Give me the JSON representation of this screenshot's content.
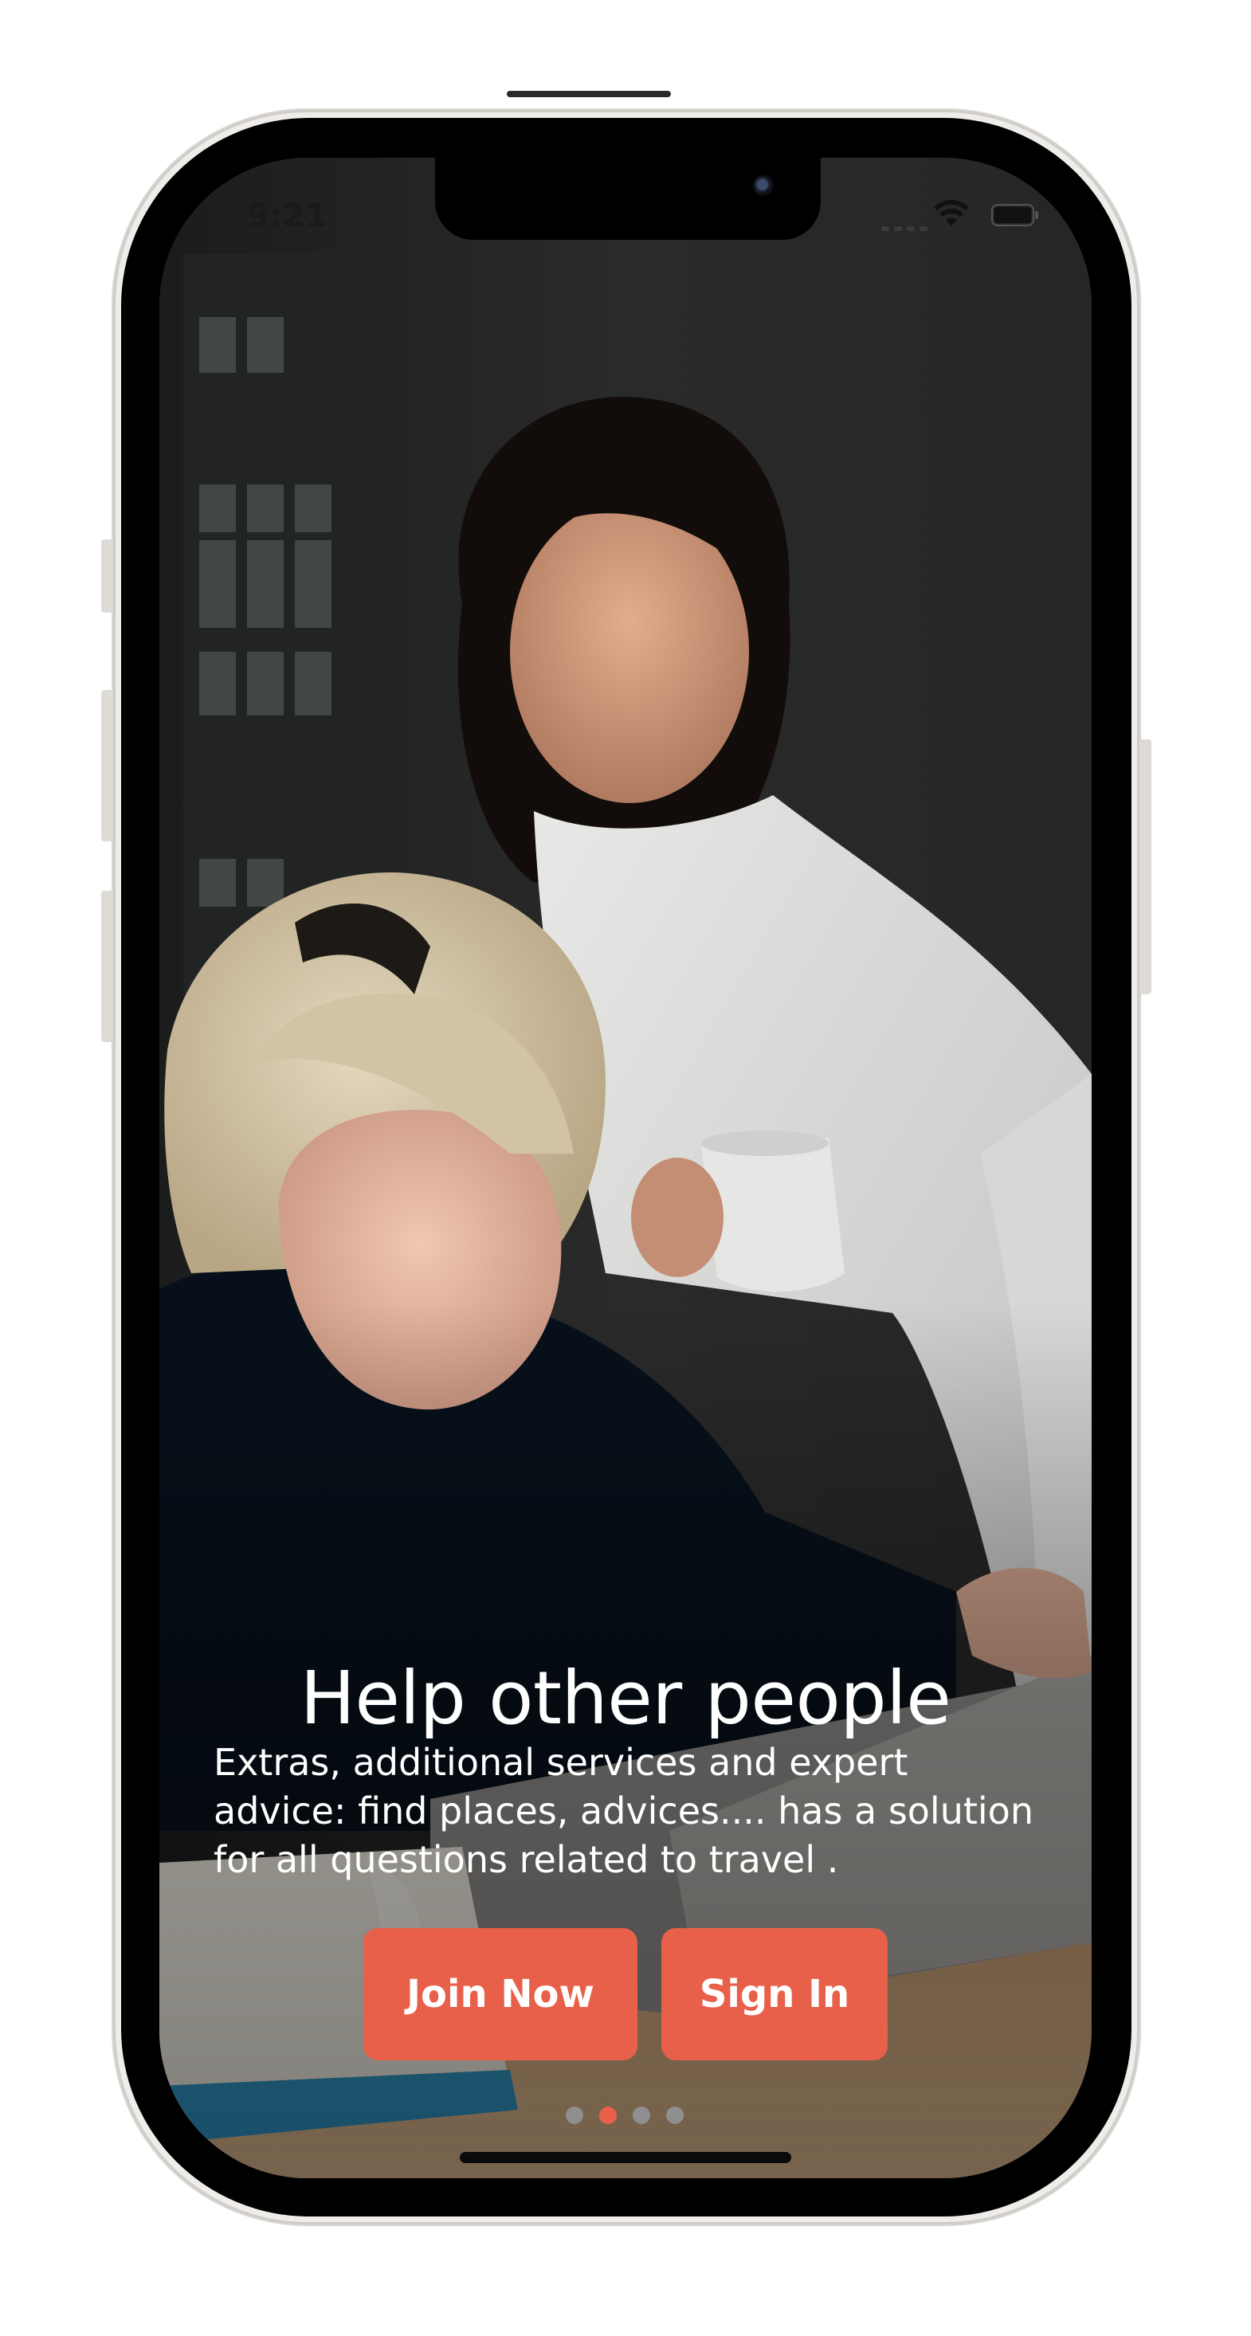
{
  "status_bar": {
    "time": "9:21"
  },
  "onboarding": {
    "title": "Help other people",
    "description": "Extras, additional services and expert advice: find places, advices.... has a solution for all questions related to travel .",
    "join_label": "Join Now",
    "signin_label": "Sign In",
    "page_count": 4,
    "active_page": 2
  },
  "colors": {
    "accent": "#e8604a",
    "inactive_dot": "#8f8f8f"
  },
  "icons": {
    "wifi": "wifi-icon",
    "battery": "battery-icon",
    "signal": "cellular-signal-icon"
  }
}
